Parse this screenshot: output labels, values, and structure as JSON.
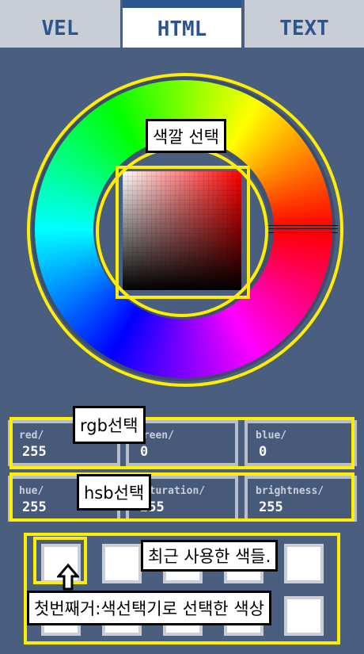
{
  "tabs": [
    {
      "label": "VEL",
      "active": false
    },
    {
      "label": "HTML",
      "active": true
    },
    {
      "label": "TEXT",
      "active": false
    }
  ],
  "annotations": {
    "color_picker": "색깔 선택",
    "rgb": "rgb선택",
    "hsb": "hsb선택",
    "recent": "최근 사용한 색들.",
    "first": "첫번째거:색선택기로 선택한 색상"
  },
  "rgb_fields": [
    {
      "label": "red/",
      "value": "255"
    },
    {
      "label": "green/",
      "value": "0"
    },
    {
      "label": "blue/",
      "value": "0"
    }
  ],
  "hsb_fields": [
    {
      "label": "hue/",
      "value": "255"
    },
    {
      "label": "saturation/",
      "value": "255"
    },
    {
      "label": "brightness/",
      "value": "255"
    }
  ],
  "colors": {
    "background": "#4a5f80",
    "tab": "#c8cdd6",
    "tab_text": "#2a5590",
    "highlight": "#ffee00",
    "current_color": "#ff0000"
  },
  "recent_swatches": [
    "#ffffff",
    "#ffffff",
    "#ffffff",
    "#ffffff",
    "#ffffff",
    "#ffffff",
    "#ffffff",
    "#ffffff",
    "#ffffff",
    "#ffffff"
  ]
}
